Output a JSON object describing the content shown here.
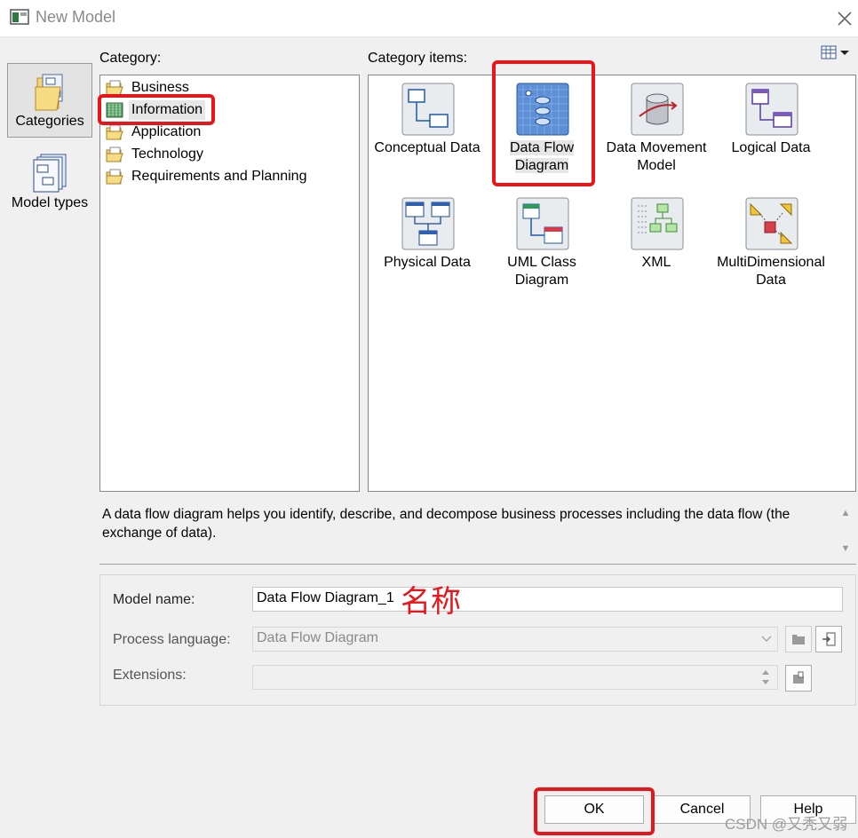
{
  "window": {
    "title": "New Model"
  },
  "sidebar": {
    "items": [
      {
        "label": "Categories",
        "icon": "categories-icon",
        "active": true
      },
      {
        "label": "Model types",
        "icon": "model-types-icon",
        "active": false
      }
    ]
  },
  "category_panel": {
    "label": "Category:",
    "items": [
      {
        "label": "Business",
        "icon": "folder-icon",
        "selected": false
      },
      {
        "label": "Information",
        "icon": "information-folder-icon",
        "selected": true
      },
      {
        "label": "Application",
        "icon": "folder-icon",
        "selected": false
      },
      {
        "label": "Technology",
        "icon": "folder-icon",
        "selected": false
      },
      {
        "label": "Requirements and Planning",
        "icon": "folder-icon",
        "selected": false
      }
    ]
  },
  "items_panel": {
    "label": "Category items:",
    "view_icon": "view-options-icon",
    "items": [
      {
        "label1": "Conceptual Data",
        "label2": "",
        "icon": "conceptual-data-icon",
        "selected": false
      },
      {
        "label1": "Data Flow",
        "label2": "Diagram",
        "icon": "data-flow-diagram-icon",
        "selected": true
      },
      {
        "label1": "Data Movement",
        "label2": "Model",
        "icon": "data-movement-icon",
        "selected": false
      },
      {
        "label1": "Logical Data",
        "label2": "",
        "icon": "logical-data-icon",
        "selected": false
      },
      {
        "label1": "Physical Data",
        "label2": "",
        "icon": "physical-data-icon",
        "selected": false
      },
      {
        "label1": "UML Class",
        "label2": "Diagram",
        "icon": "uml-class-icon",
        "selected": false
      },
      {
        "label1": "XML",
        "label2": "",
        "icon": "xml-icon",
        "selected": false
      },
      {
        "label1": "MultiDimensional",
        "label2": "Data",
        "icon": "multidimensional-icon",
        "selected": false
      }
    ]
  },
  "description": "A data flow diagram helps you identify, describe, and decompose business processes including the data flow (the exchange of data).",
  "form": {
    "model_name_label": "Model name:",
    "model_name_value": "Data Flow Diagram_1",
    "process_language_label": "Process language:",
    "process_language_value": "Data Flow Diagram",
    "extensions_label": "Extensions:",
    "extensions_value": ""
  },
  "annotation": "名称",
  "buttons": {
    "ok": "OK",
    "cancel": "Cancel",
    "help": "Help"
  },
  "watermark": "CSDN @又秃又弱",
  "colors": {
    "highlight_red": "#e8151b",
    "selection_gray": "#e6e6e6",
    "background": "#f0f0f0"
  }
}
